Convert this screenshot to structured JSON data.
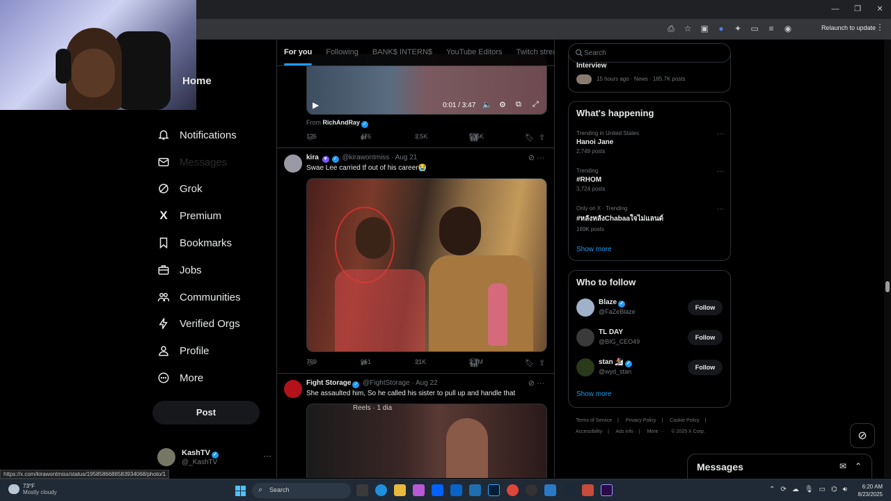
{
  "browser": {
    "window_controls": [
      "—",
      "❐",
      "✕"
    ],
    "relaunch_label": "Relaunch to update"
  },
  "nav": {
    "items": [
      {
        "label": "Home"
      },
      {
        "label": "Notifications"
      },
      {
        "label": "Messages"
      },
      {
        "label": "Grok"
      },
      {
        "label": "Premium"
      },
      {
        "label": "Bookmarks"
      },
      {
        "label": "Jobs"
      },
      {
        "label": "Communities"
      },
      {
        "label": "Verified Orgs"
      },
      {
        "label": "Profile"
      },
      {
        "label": "More"
      }
    ],
    "post_label": "Post",
    "account": {
      "name": "KashTV",
      "handle": "@_KashTV"
    }
  },
  "tabs": [
    "For you",
    "Following",
    "BANK$ INTERN$",
    "YouTube Editors",
    "Twitch streame"
  ],
  "feed": {
    "tweet1": {
      "video_time": "0:01 / 3:47",
      "from_label": "From",
      "from_name": "RichAndRay",
      "replies": "126",
      "reposts": "476",
      "likes": "3.5K",
      "views": "585K"
    },
    "tweet2": {
      "name": "kira",
      "handle": "@kirawontmiss",
      "date": "· Aug 21",
      "text": "Swae Lee carried tf out of his career😭",
      "replies": "769",
      "reposts": "961",
      "likes": "31K",
      "views": "2.7M"
    },
    "tweet3": {
      "name": "Fight Storage",
      "handle": "@FightStorage",
      "date": "· Aug 22",
      "text": "She assaulted him, So he called his sister to pull up and handle that",
      "media_label": "Reels · 1 dia"
    }
  },
  "right": {
    "search_placeholder": "Search",
    "top_news": {
      "title": "Interview",
      "meta": "15 hours ago · News · 185.7K posts"
    },
    "happening": {
      "title": "What's happening",
      "trends": [
        {
          "meta": "Trending in United States",
          "title": "Hanoi Jane",
          "count": "2,749 posts"
        },
        {
          "meta": "Trending",
          "title": "#RHOM",
          "count": "3,724 posts"
        },
        {
          "meta": "Only on X · Trending",
          "title": "#หลังหลังChabaaใจไม่แลนด์",
          "count": "169K posts"
        }
      ],
      "show_more": "Show more"
    },
    "who_to_follow": {
      "title": "Who to follow",
      "users": [
        {
          "name": "Blaze",
          "handle": "@FaZeBlaze",
          "button": "Follow"
        },
        {
          "name": "TL DAY",
          "handle": "@BIG_CEO49",
          "button": "Follow"
        },
        {
          "name": "stan 🏂",
          "handle": "@wyd_stan",
          "button": "Follow"
        }
      ],
      "show_more": "Show more"
    },
    "footer": [
      "Terms of Service",
      "|",
      "Privacy Policy",
      "|",
      "Cookie Policy",
      "|",
      "Accessibility",
      "|",
      "Ads info",
      "|",
      "More ···",
      "© 2025 X Corp."
    ]
  },
  "messages_drawer": {
    "title": "Messages"
  },
  "status_url": "https://x.com/kirawontmiss/status/1958586688583934068/photo/1",
  "taskbar": {
    "weather_temp": "73°F",
    "weather_cond": "Mostly cloudy",
    "search_label": "Search",
    "time": "6:20 AM",
    "date": "8/23/2025"
  },
  "colors": {
    "accent": "#1d9bf0",
    "background": "#000000",
    "border": "#2f3336",
    "muted": "#71767b"
  }
}
